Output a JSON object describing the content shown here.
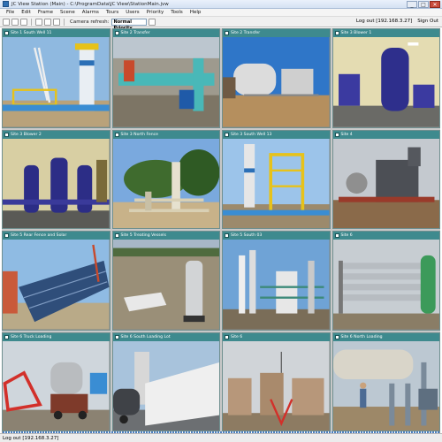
{
  "window": {
    "title": "JC View Station (Main) - C:\\ProgramData\\JC View\\StationMain.jvw",
    "minimize": "_",
    "maximize": "□",
    "close": "✕"
  },
  "menu": [
    "File",
    "Edit",
    "Frame",
    "Scene",
    "Alarms",
    "Tours",
    "Users",
    "Priority",
    "Tools",
    "Help"
  ],
  "toolbar": {
    "label": "Camera refresh:",
    "select_value": "Normal Priority",
    "user_text": "Log out [192.168.3.27]",
    "sign_out": "Sign Out"
  },
  "cameras": [
    {
      "label": "Site 1 South Well 11",
      "scene": "derrick"
    },
    {
      "label": "Site 2 Transfer",
      "scene": "pipes-teal"
    },
    {
      "label": "Site 2 Transfer",
      "scene": "tanks-yard"
    },
    {
      "label": "Site 3 Blower 1",
      "scene": "indoor-pump"
    },
    {
      "label": "Site 3 Blower 2",
      "scene": "indoor-pumps"
    },
    {
      "label": "Site 3 North Fence",
      "scene": "wellhead-trees"
    },
    {
      "label": "Site 3 South Well 13",
      "scene": "yellow-rig"
    },
    {
      "label": "Site 4",
      "scene": "compressor"
    },
    {
      "label": "Site 5 Rear Fence and Solar",
      "scene": "solar"
    },
    {
      "label": "Site 5 Treating Vessels",
      "scene": "vessel"
    },
    {
      "label": "Site 5 South 03",
      "scene": "refinery"
    },
    {
      "label": "Site 6",
      "scene": "pipe-rack"
    },
    {
      "label": "Site 6 Truck Loading",
      "scene": "truck-loading"
    },
    {
      "label": "Site 6 South Loading Lot",
      "scene": "white-tank"
    },
    {
      "label": "Site 6",
      "scene": "tank-battery"
    },
    {
      "label": "Site 6 North Loading",
      "scene": "loading-worker"
    }
  ],
  "status": "Log out [192.168.3.27]"
}
